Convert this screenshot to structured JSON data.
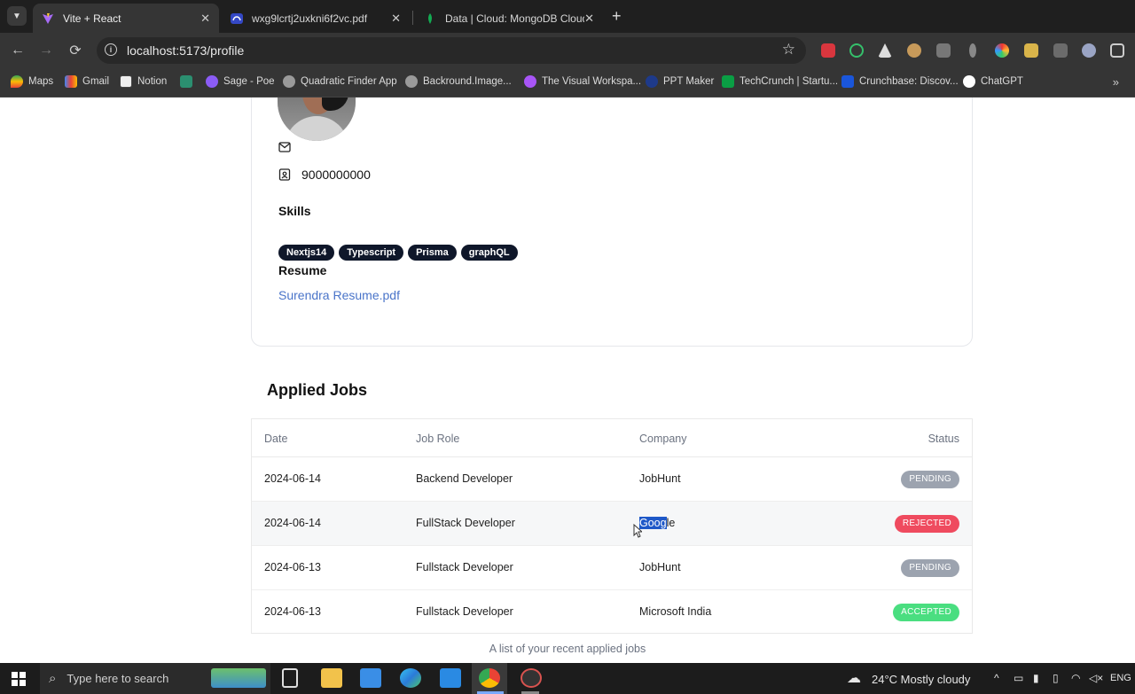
{
  "browser": {
    "tabs": [
      {
        "title": "Vite + React",
        "active": true
      },
      {
        "title": "wxg9lcrtj2uxkni6f2vc.pdf",
        "active": false
      },
      {
        "title": "Data | Cloud: MongoDB Cloud",
        "active": false
      }
    ],
    "url": "localhost:5173/profile",
    "bookmarks": [
      "Maps",
      "Gmail",
      "Notion",
      "Sage - Poe",
      "Quadratic Finder App",
      "Backround.Image...",
      "The Visual Workspa...",
      "PPT Maker",
      "TechCrunch | Startu...",
      "Crunchbase: Discov...",
      "ChatGPT"
    ]
  },
  "profile": {
    "phone": "9000000000",
    "skills_title": "Skills",
    "skills": [
      "Nextjs14",
      "Typescript",
      "Prisma",
      "graphQL"
    ],
    "resume_title": "Resume",
    "resume_file": "Surendra Resume.pdf"
  },
  "applied_jobs": {
    "title": "Applied Jobs",
    "columns": {
      "date": "Date",
      "role": "Job Role",
      "company": "Company",
      "status": "Status"
    },
    "rows": [
      {
        "date": "2024-06-14",
        "role": "Backend Developer",
        "company": "JobHunt",
        "status": "PENDING"
      },
      {
        "date": "2024-06-14",
        "role": "FullStack Developer",
        "company_selected": "Goog",
        "company_rest": "le",
        "status": "REJECTED"
      },
      {
        "date": "2024-06-13",
        "role": "Fullstack Developer",
        "company": "JobHunt",
        "status": "PENDING"
      },
      {
        "date": "2024-06-13",
        "role": "Fullstack Developer",
        "company": "Microsoft India",
        "status": "ACCEPTED"
      }
    ],
    "caption": "A list of your recent applied jobs",
    "status_colors": {
      "PENDING": "#9ca3af",
      "REJECTED": "#ef4b5f",
      "ACCEPTED": "#4ade80"
    }
  },
  "taskbar": {
    "search_placeholder": "Type here to search",
    "weather": "24°C  Mostly cloudy",
    "language": "ENG"
  }
}
